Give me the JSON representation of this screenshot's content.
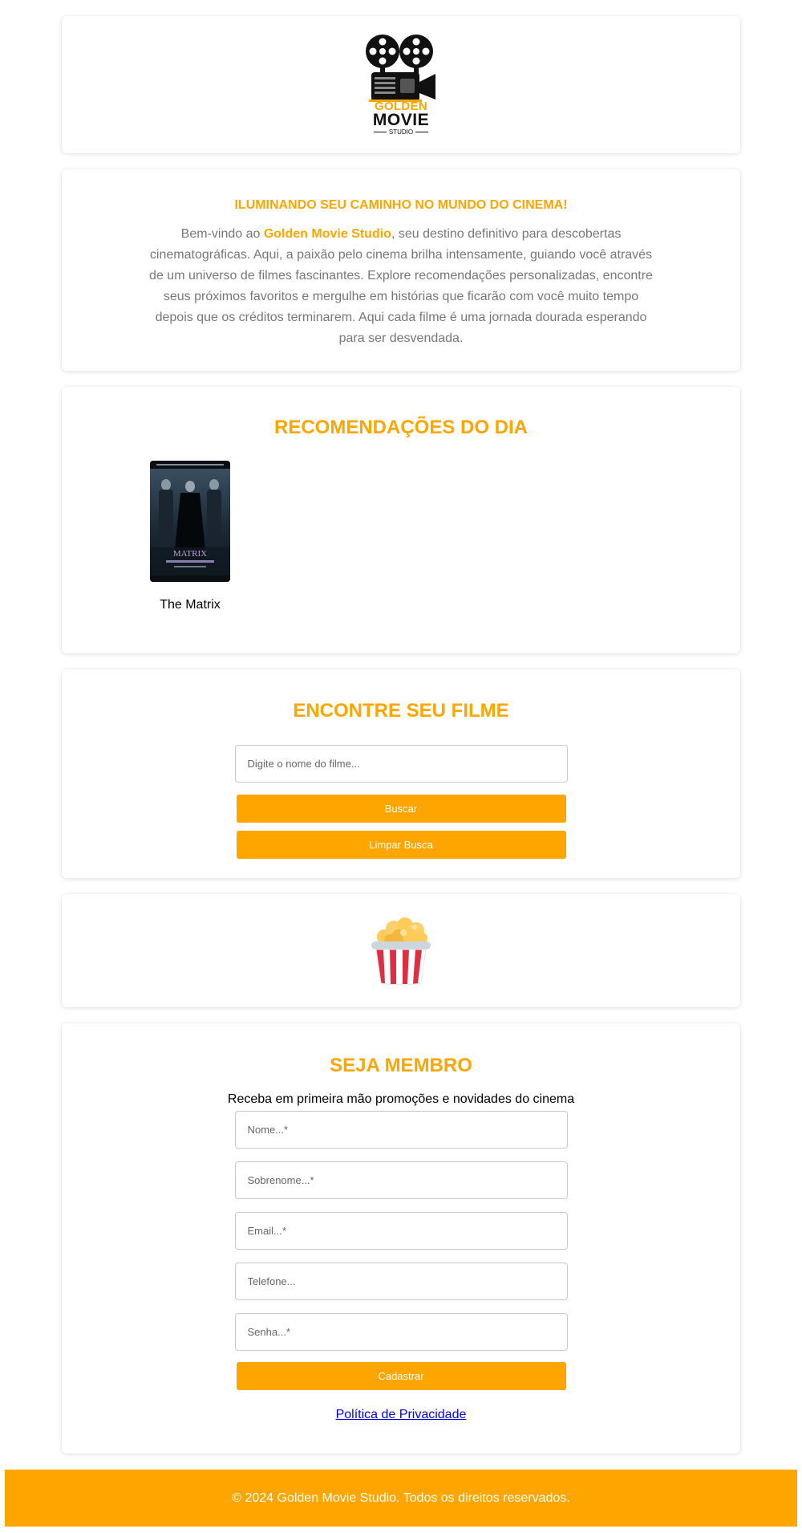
{
  "logo": {
    "line1": "GOLDEN",
    "line2": "MOVIE",
    "line3": "STUDIO"
  },
  "intro": {
    "tagline": "ILUMINANDO SEU CAMINHO NO MUNDO DO CINEMA!",
    "text_before": "Bem-vindo ao ",
    "brand": "Golden Movie Studio",
    "text_after": ", seu destino definitivo para descobertas cinematográficas. Aqui, a paixão pelo cinema brilha intensamente, guiando você através de um universo de filmes fascinantes. Explore recomendações personalizadas, encontre seus próximos favoritos e mergulhe em histórias que ficarão com você muito tempo depois que os créditos terminarem. Aqui cada filme é uma jornada dourada esperando para ser desvendada."
  },
  "recommendations": {
    "title": "RECOMENDAÇÕES DO DIA",
    "movies": [
      {
        "title": "The Matrix",
        "poster_text": "MATRIX"
      }
    ]
  },
  "search": {
    "title": "ENCONTRE SEU FILME",
    "placeholder": "Digite o nome do filme...",
    "search_button": "Buscar",
    "clear_button": "Limpar Busca"
  },
  "member": {
    "title": "SEJA MEMBRO",
    "subtitle": "Receba em primeira mão promoções e novidades do cinema",
    "fields": {
      "first_name": "Nome...*",
      "last_name": "Sobrenome...*",
      "email": "Email...*",
      "phone": "Telefone...",
      "password": "Senha...*"
    },
    "register_button": "Cadastrar",
    "privacy_link": "Política de Privacidade"
  },
  "footer": {
    "text": "© 2024 Golden Movie Studio. Todos os direitos reservados."
  },
  "colors": {
    "accent": "#ffa500",
    "body_text": "#777777",
    "link": "#0000ee"
  },
  "icons": {
    "logo": "film-projector-icon",
    "popcorn": "popcorn-icon"
  }
}
